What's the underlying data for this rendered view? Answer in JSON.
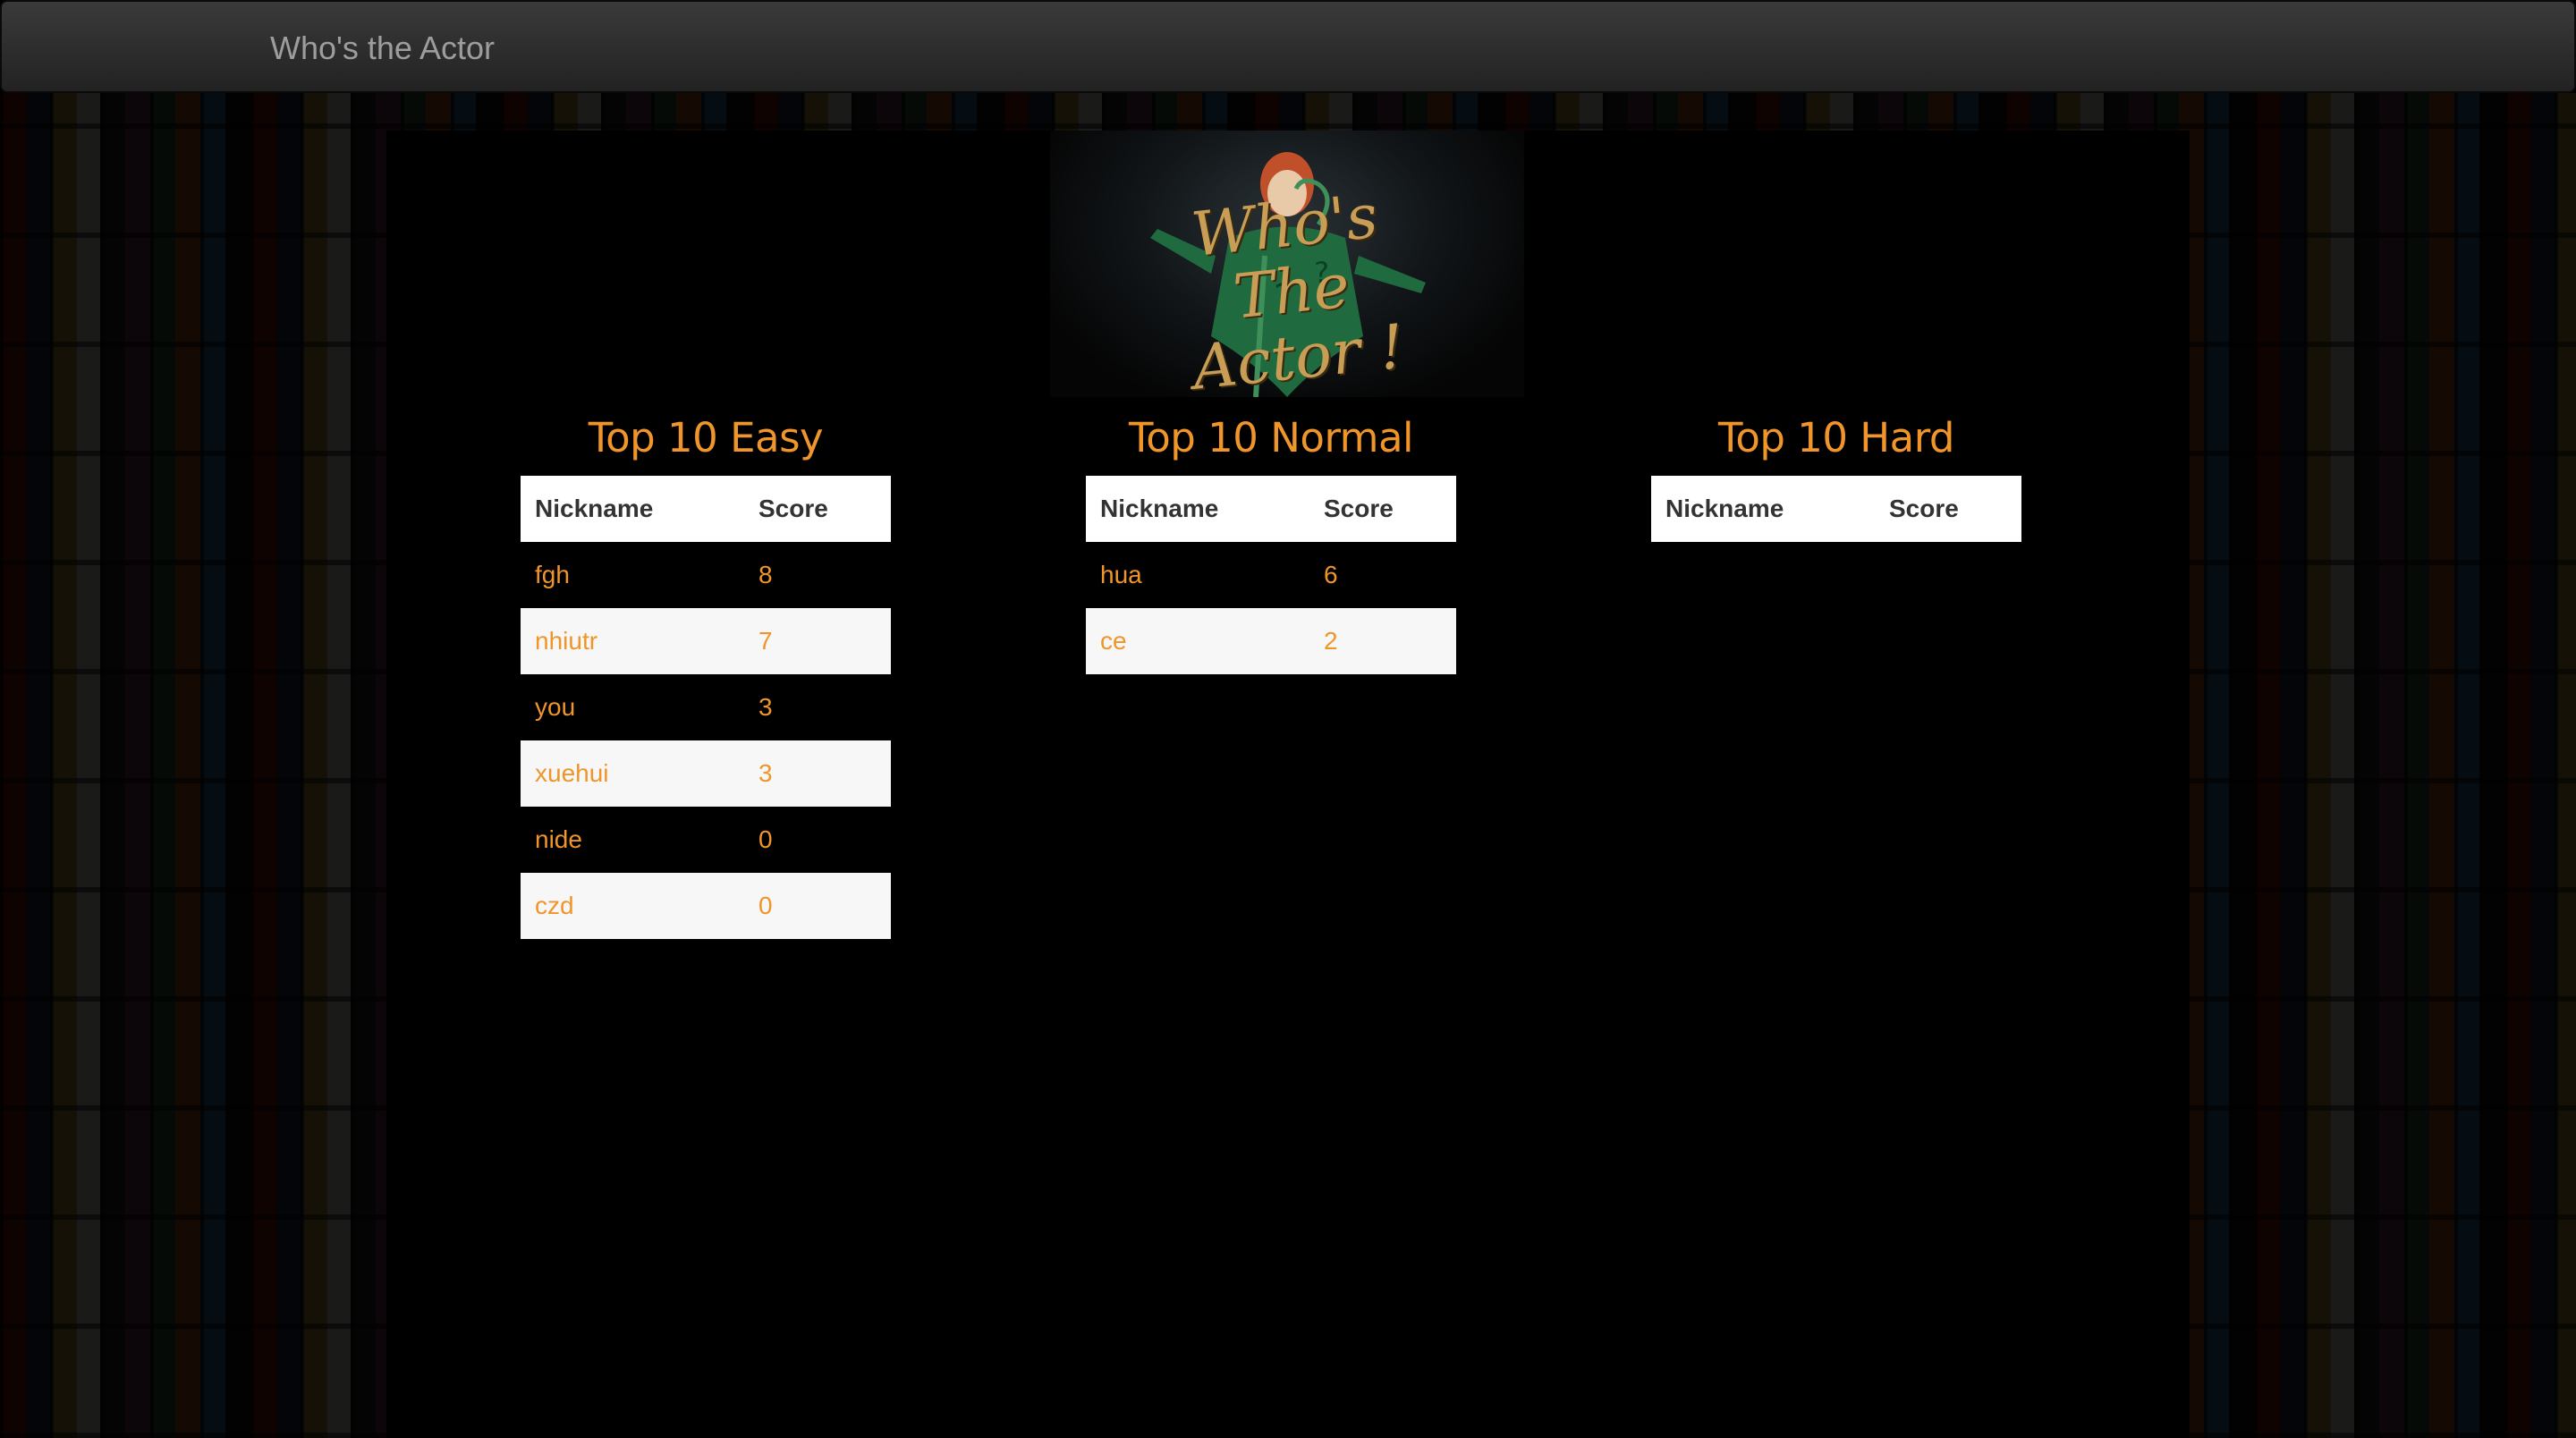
{
  "navbar": {
    "brand": "Who's the Actor"
  },
  "logo": {
    "line1": "Who's The",
    "line2": "Actor !"
  },
  "leaderboards": [
    {
      "title": "Top 10 Easy",
      "columns": [
        "Nickname",
        "Score"
      ],
      "rows": [
        {
          "nickname": "fgh",
          "score": "8"
        },
        {
          "nickname": "nhiutr",
          "score": "7"
        },
        {
          "nickname": "you",
          "score": "3"
        },
        {
          "nickname": "xuehui",
          "score": "3"
        },
        {
          "nickname": "nide",
          "score": "0"
        },
        {
          "nickname": "czd",
          "score": "0"
        }
      ]
    },
    {
      "title": "Top 10 Normal",
      "columns": [
        "Nickname",
        "Score"
      ],
      "rows": [
        {
          "nickname": "hua",
          "score": "6"
        },
        {
          "nickname": "ce",
          "score": "2"
        }
      ]
    },
    {
      "title": "Top 10 Hard",
      "columns": [
        "Nickname",
        "Score"
      ],
      "rows": []
    }
  ],
  "colors": {
    "accent": "#f0952a",
    "navbar": "#222222",
    "brand_text": "#9d9d9d",
    "table_header_bg": "#ffffff",
    "striped_row_bg": "#f7f7f7"
  }
}
